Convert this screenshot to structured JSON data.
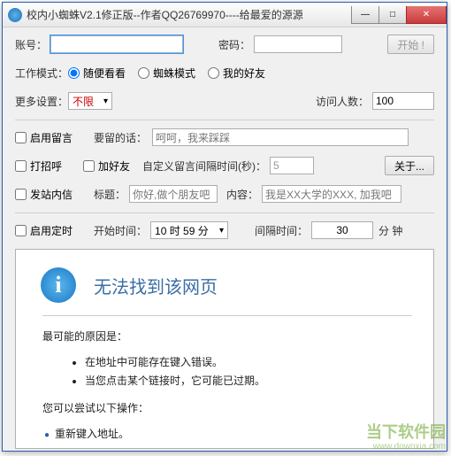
{
  "window": {
    "title": "校内小蜘蛛V2.1修正版--作者QQ26769970----给最爱的源源",
    "min": "—",
    "max": "□",
    "close": "✕"
  },
  "login": {
    "account_label": "账号：",
    "account_value": "",
    "password_label": "密码：",
    "password_value": "",
    "start_btn": "开始 !"
  },
  "mode": {
    "label": "工作模式：",
    "opt1": "随便看看",
    "opt2": "蜘蛛模式",
    "opt3": "我的好友"
  },
  "more": {
    "label": "更多设置：",
    "value": "不限",
    "visit_label": "访问人数：",
    "visit_value": "100"
  },
  "msg": {
    "enable": "启用留言",
    "say_label": "要留的话：",
    "say_value": "呵呵，我来踩踩"
  },
  "greet": {
    "hello": "打招呼",
    "addfriend": "加好友",
    "interval_label": "自定义留言间隔时间(秒)：",
    "interval_value": "5",
    "about_btn": "关于..."
  },
  "mail": {
    "enable": "发站内信",
    "title_label": "标题：",
    "title_value": "你好,做个朋友吧",
    "content_label": "内容：",
    "content_value": "我是XX大学的XXX, 加我吧"
  },
  "timer": {
    "enable": "启用定时",
    "start_label": "开始时间：",
    "start_value": "10 时 59 分",
    "interval_label": "间隔时间：",
    "interval_value": "30",
    "unit": "分 钟"
  },
  "error": {
    "title": "无法找到该网页",
    "cause_heading": "最可能的原因是：",
    "cause1": "在地址中可能存在键入错误。",
    "cause2": "当您点击某个链接时，它可能已过期。",
    "try_heading": "您可以尝试以下操作：",
    "try1": "重新键入地址。"
  },
  "watermark": {
    "line1": "当下软件园",
    "line2": "www.downxia.com"
  }
}
